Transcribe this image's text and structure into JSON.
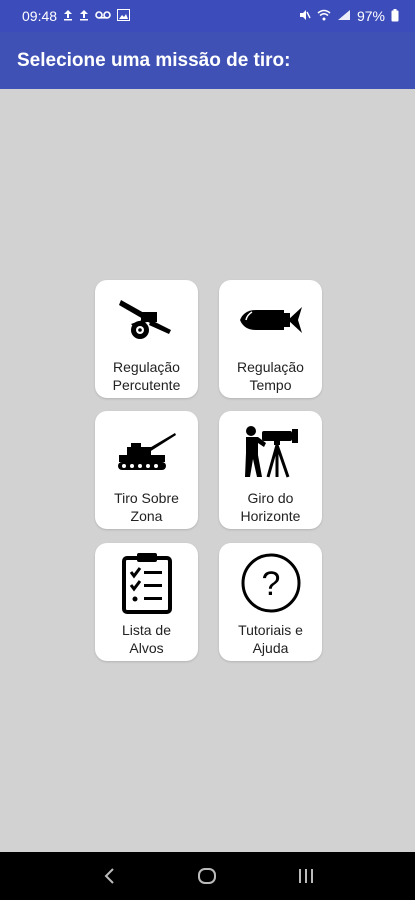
{
  "status_bar": {
    "time": "09:48",
    "battery": "97%",
    "icons_left": [
      "upload-icon",
      "upload-icon",
      "voicemail-icon",
      "image-icon"
    ],
    "icons_right": [
      "mute-icon",
      "wifi-icon",
      "signal-icon",
      "battery-icon"
    ]
  },
  "app_bar": {
    "title": "Selecione uma missão de tiro:",
    "color": "#3f51b5"
  },
  "menu": {
    "items": [
      {
        "label": "Regulação\nPercutente",
        "icon": "howitzer-icon"
      },
      {
        "label": "Regulação\nTempo",
        "icon": "shell-icon"
      },
      {
        "label": "Tiro Sobre\nZona",
        "icon": "self-propelled-gun-icon"
      },
      {
        "label": "Giro do\nHorizonte",
        "icon": "surveyor-theodolite-icon"
      },
      {
        "label": "Lista de\nAlvos",
        "icon": "clipboard-checklist-icon"
      },
      {
        "label": "Tutoriais e\nAjuda",
        "icon": "help-circle-icon"
      }
    ]
  },
  "nav_bar": {
    "buttons": [
      "back-icon",
      "home-icon",
      "recents-icon"
    ]
  }
}
